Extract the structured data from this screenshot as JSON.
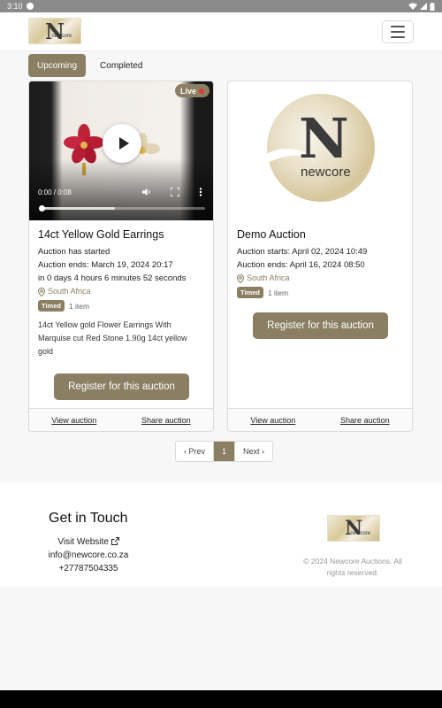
{
  "status_bar": {
    "time": "3:10"
  },
  "nav": {
    "logo_letter": "N",
    "logo_sub": "newcore",
    "menu_icon": "hamburger-icon"
  },
  "tabs": [
    {
      "label": "Upcoming",
      "active": true
    },
    {
      "label": "Completed",
      "active": false
    }
  ],
  "auctions": [
    {
      "live_label": "Live",
      "video": {
        "time": "0:00 / 0:08",
        "progress": 0.0,
        "buffered": 0.45
      },
      "title": "14ct Yellow Gold Earrings",
      "status": "Auction has started",
      "ends": "Auction ends: March 19, 2024 20:17",
      "countdown": "in 0 days 4 hours 6 minutes 52 seconds",
      "location": "South Africa",
      "badge": "Timed",
      "items": "1 item",
      "description": "14ct Yellow gold Flower Earrings With Marquise cut Red Stone 1.90g 14ct yellow gold",
      "register_label": "Register for this auction",
      "view_label": "View auction",
      "share_label": "Share auction"
    },
    {
      "logo_letter": "N",
      "logo_sub": "newcore",
      "title": "Demo Auction",
      "starts": "Auction starts: April 02, 2024 10:49",
      "ends": "Auction ends: April 16, 2024 08:50",
      "location": "South Africa",
      "badge": "Timed",
      "items": "1 item",
      "register_label": "Register for this auction",
      "view_label": "View auction",
      "share_label": "Share auction"
    }
  ],
  "pagination": {
    "prev": "‹ Prev",
    "current": "1",
    "next": "Next ›"
  },
  "footer": {
    "title": "Get in Touch",
    "website": "Visit Website",
    "email": "info@newcore.co.za",
    "phone": "+27787504335",
    "copyright": "© 2024 Newcore Auctions. All rights reserved."
  },
  "colors": {
    "accent": "#8a7f62",
    "live_dot": "#e03a3a"
  }
}
